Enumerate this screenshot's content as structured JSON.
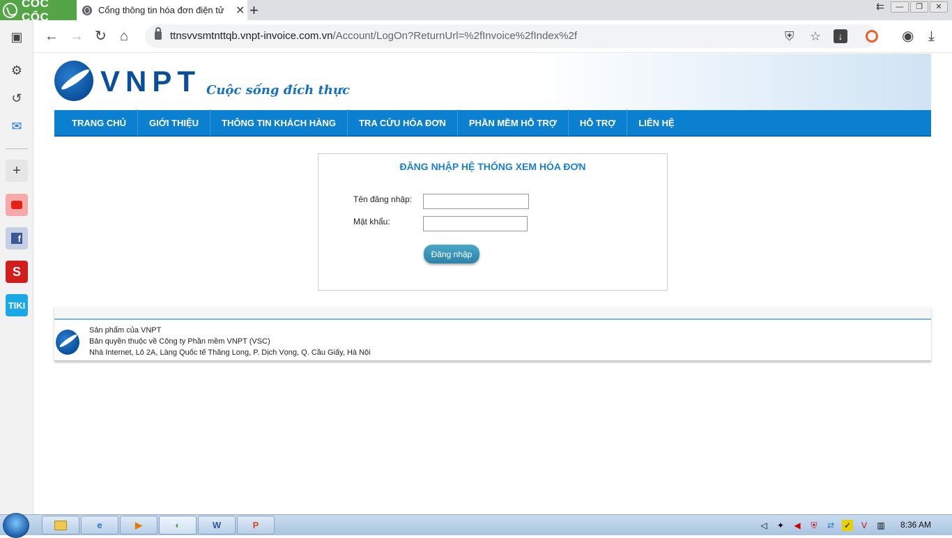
{
  "browser": {
    "brand_name": "CỐC CỐC",
    "tab_title": "Cổng thông tin hóa đơn điện tử",
    "tab_close": "✕",
    "new_tab": "+",
    "url_host": "ttnsvvsmtnttqb.vnpt-invoice.com.vn",
    "url_path": "/Account/LogOn?ReturnUrl=%2fInvoice%2fIndex%2f"
  },
  "site": {
    "logo_text": "VNPT",
    "slogan": "Cuộc sống đích thực"
  },
  "nav": {
    "items": [
      {
        "label": "TRANG CHỦ"
      },
      {
        "label": "GIỚI THIỆU"
      },
      {
        "label": "THÔNG TIN KHÁCH HÀNG"
      },
      {
        "label": "TRA CỨU HÓA ĐƠN"
      },
      {
        "label": "PHẦN MỀM HỖ TRỢ"
      },
      {
        "label": "HỖ TRỢ"
      },
      {
        "label": "LIÊN HỆ"
      }
    ]
  },
  "login": {
    "title": "ĐĂNG NHẬP HỆ THỐNG XEM HÓA ĐƠN",
    "username_label": "Tên đăng nhập:",
    "username_value": "",
    "password_label": "Mật khẩu:",
    "password_value": "",
    "submit_label": "Đăng nhập"
  },
  "footer": {
    "line1": "Sản phẩm của VNPT",
    "line2": "Bản quyền thuộc về Công ty Phần mềm VNPT (VSC)",
    "line3": "Nhà Internet, Lô 2A, Làng Quốc tế Thăng Long, P. Dịch Vọng, Q. Cầu Giấy, Hà Nội"
  },
  "taskbar": {
    "clock": "8:36 AM"
  },
  "colors": {
    "nav_blue": "#0b7fd0",
    "brand_green": "#53a546",
    "vnpt_blue": "#0b4f9c",
    "login_title": "#1a7fd0"
  }
}
